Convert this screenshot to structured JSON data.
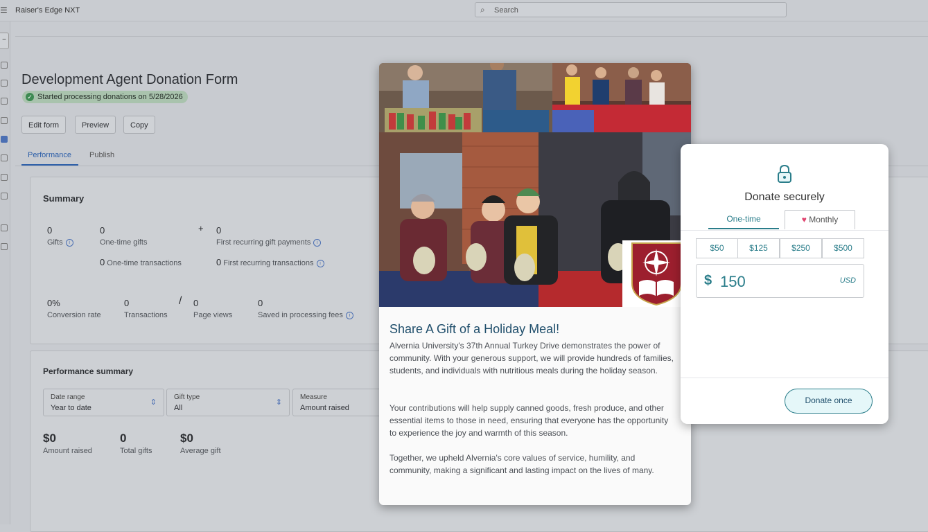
{
  "app": {
    "title": "Raiser's Edge NXT"
  },
  "search": {
    "placeholder": "Search"
  },
  "page": {
    "title": "Development Agent Donation Form",
    "status": "Started processing donations on 5/28/2026",
    "actions": {
      "edit": "Edit form",
      "preview": "Preview",
      "copy": "Copy"
    },
    "tabs": [
      "Performance",
      "Publish"
    ]
  },
  "summary": {
    "title": "Summary",
    "gifts": {
      "value": "0",
      "label": "Gifts"
    },
    "one_time_gifts": {
      "value": "0",
      "label": "One-time gifts"
    },
    "plus": "+",
    "first_recurring": {
      "value": "0",
      "label": "First recurring gift payments"
    },
    "one_time_transactions": {
      "value": "0",
      "label": "One-time transactions"
    },
    "first_recurring_transactions": {
      "value": "0",
      "label": "First recurring transactions"
    },
    "conversion": {
      "value": "0%",
      "label": "Conversion rate"
    },
    "transactions": {
      "value": "0",
      "label": "Transactions"
    },
    "slash": "/",
    "page_views": {
      "value": "0",
      "label": "Page views"
    },
    "fees": {
      "value": "0",
      "label": "Saved in processing fees"
    }
  },
  "performance": {
    "title": "Performance summary",
    "filters": [
      {
        "label": "Date range",
        "value": "Year to date"
      },
      {
        "label": "Gift type",
        "value": "All"
      },
      {
        "label": "Measure",
        "value": "Amount raised"
      }
    ],
    "stats": [
      {
        "value": "$0",
        "label": "Amount raised"
      },
      {
        "value": "0",
        "label": "Total gifts"
      },
      {
        "value": "$0",
        "label": "Average gift"
      }
    ]
  },
  "form_preview": {
    "heading": "Share A Gift of a Holiday Meal!",
    "paragraphs": [
      "Alvernia University's 37th Annual Turkey Drive demonstrates the power of community. With your generous support, we will provide hundreds of families, students, and individuals with nutritious meals during the holiday season.",
      "Your contributions will help supply canned goods, fresh produce, and other essential items to those in need, ensuring that everyone has the opportunity to experience the joy and warmth of this season.",
      "Together, we upheld Alvernia's core values of service, humility, and community, making a significant and lasting impact on the lives of many."
    ]
  },
  "donate": {
    "title": "Donate securely",
    "freq_one_time": "One-time",
    "freq_monthly": "Monthly",
    "amounts": [
      "$50",
      "$125",
      "$250",
      "$500"
    ],
    "currency_symbol": "$",
    "amount_value": "150",
    "currency_code": "USD",
    "submit": "Donate once",
    "accent_color": "#2a7d8a"
  },
  "icons": [
    "menu-icon",
    "search-icon",
    "check-icon",
    "info-icon",
    "chevron-updown-icon",
    "lock-icon",
    "heart-icon",
    "crest-logo"
  ]
}
